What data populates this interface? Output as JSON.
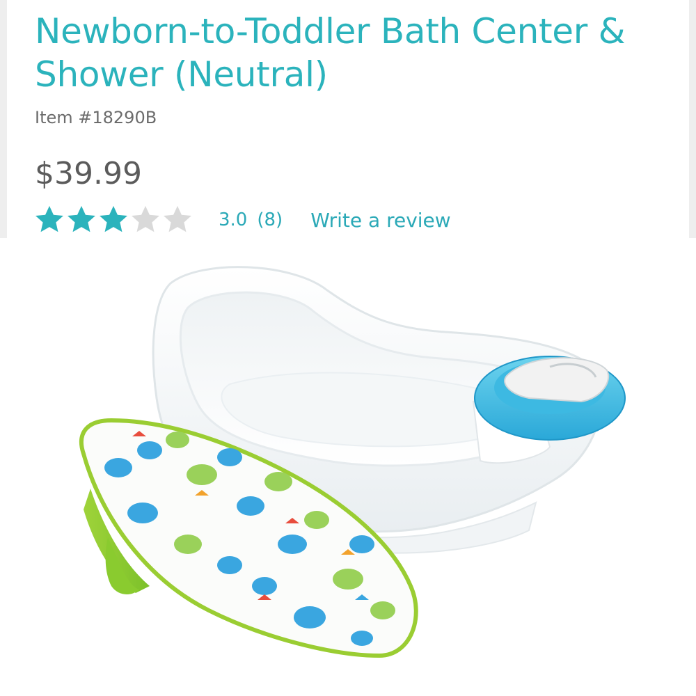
{
  "product": {
    "title": "Newborn-to-Toddler Bath Center & Shower (Neutral)",
    "item_number": "Item #18290B",
    "price": "$39.99"
  },
  "rating": {
    "value": 3.0,
    "stars_filled": 3,
    "stars_total": 5,
    "value_label": "3.0",
    "count_label": "(8)",
    "write_review_label": "Write a review"
  },
  "image": {
    "subject": "bath tub with shower sprayer and infant bath sling"
  },
  "colors": {
    "accent": "#2bb3bc",
    "star_filled": "#2bb3bc",
    "star_empty": "#d9d9d9",
    "price_text": "#5b5b5b"
  }
}
